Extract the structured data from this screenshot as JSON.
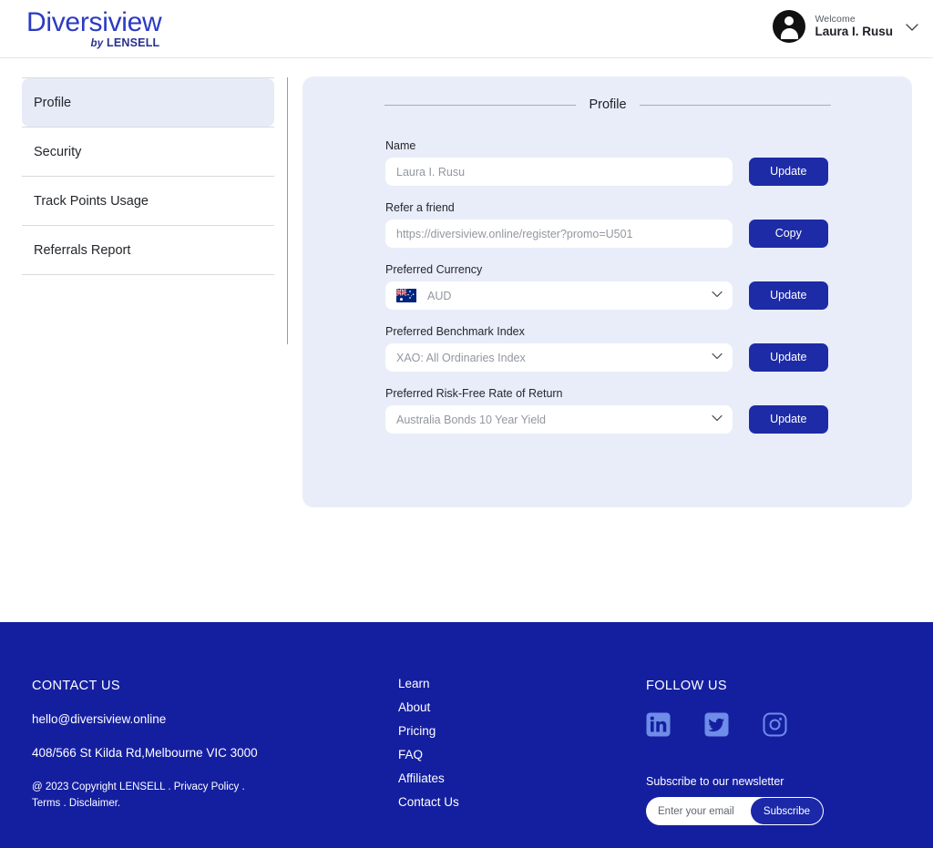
{
  "header": {
    "brand_main": "Diversiview",
    "brand_by": "by",
    "brand_lensell": "LENSELL",
    "welcome_label": "Welcome",
    "user_name": "Laura I. Rusu",
    "chevron": "∨",
    "avatar_icon": "user-avatar-icon"
  },
  "sidebar": {
    "items": [
      {
        "label": "Profile",
        "active": true
      },
      {
        "label": "Security",
        "active": false
      },
      {
        "label": "Track Points Usage",
        "active": false
      },
      {
        "label": "Referrals Report",
        "active": false
      }
    ]
  },
  "panel": {
    "title": "Profile",
    "fields": [
      {
        "label": "Name",
        "value": "Laura I. Rusu",
        "placeholder": "Laura I. Rusu",
        "type": "text",
        "button": "Update",
        "name": "name"
      },
      {
        "label": "Refer a friend",
        "value": "https://diversiview.online/register?promo=U501",
        "placeholder": "https://diversiview.online/register?promo=U501",
        "type": "text",
        "button": "Copy",
        "name": "refer-a-friend"
      },
      {
        "label": "Preferred Currency",
        "value": "AUD",
        "type": "select-flag",
        "flag": "australia-flag-icon",
        "button": "Update",
        "name": "preferred-currency"
      },
      {
        "label": "Preferred Benchmark Index",
        "value": "XAO: All Ordinaries Index",
        "type": "select",
        "button": "Update",
        "name": "preferred-benchmark-index"
      },
      {
        "label": "Preferred Risk-Free Rate of Return",
        "value": "Australia Bonds 10 Year Yield",
        "type": "select",
        "button": "Update",
        "name": "preferred-risk-free-rate"
      }
    ]
  },
  "footer": {
    "contact_heading": "CONTACT US",
    "email": "hello@diversiview.online",
    "address": "408/566 St Kilda Rd,Melbourne VIC 3000",
    "legal": "@ 2023 Copyright LENSELL . Privacy Policy . Terms . Disclaimer.",
    "nav": [
      "Learn",
      "About",
      "Pricing",
      "FAQ",
      "Affiliates",
      "Contact Us"
    ],
    "follow_heading": "FOLLOW US",
    "social": [
      "linkedin-icon",
      "twitter-icon",
      "instagram-icon"
    ],
    "subscribe_label": "Subscribe to our newsletter",
    "subscribe_placeholder": "Enter your email",
    "subscribe_value": "",
    "subscribe_button": "Subscribe"
  },
  "colors": {
    "brand_blue": "#2b3bc4",
    "button_blue": "#1d2ba6",
    "footer_blue": "#141fa0",
    "panel_bg": "#e9edf9",
    "sidebar_active": "#e7ebf8",
    "social_icon": "#6f8ce8"
  }
}
